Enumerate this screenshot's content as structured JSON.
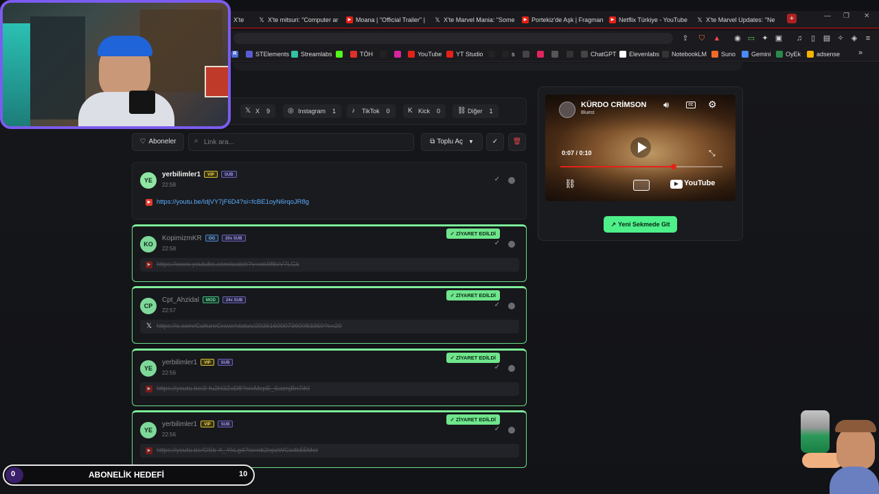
{
  "browser": {
    "tabs": [
      {
        "label": "X'te mitsuri: \"Computer ar",
        "icon": "x-icon"
      },
      {
        "label": "Moana | \"Official Trailer\" |",
        "icon": "youtube-icon"
      },
      {
        "label": "X'te Marvel Mania: \"Some",
        "icon": "x-icon"
      },
      {
        "label": "Portekiz'de Aşk | Fragman",
        "icon": "youtube-icon"
      },
      {
        "label": "Netflix Türkiye - YouTube",
        "icon": "youtube-icon"
      },
      {
        "label": "X'te Marvel Updates: \"Ne",
        "icon": "x-icon"
      }
    ],
    "first_tab_fragment": "X'te ",
    "bookmarks": [
      {
        "label": "STElements",
        "color": "#5b5bd6"
      },
      {
        "label": "Streamlabs",
        "color": "#31c3a2"
      },
      {
        "label": "",
        "color": "#53fc18"
      },
      {
        "label": "TÖH",
        "color": "#e0302a"
      },
      {
        "label": "",
        "color": "#222222"
      },
      {
        "label": "",
        "color": "#d6249f"
      },
      {
        "label": "YouTube",
        "color": "#e62117"
      },
      {
        "label": "YT Studio",
        "color": "#e62117"
      },
      {
        "label": "",
        "color": "#222222"
      },
      {
        "label": "s",
        "color": "#222222"
      },
      {
        "label": "",
        "color": "#444444"
      },
      {
        "label": "",
        "color": "#e0245e"
      },
      {
        "label": "",
        "color": "#555555"
      },
      {
        "label": "",
        "color": "#333333"
      },
      {
        "label": "ChatGPT",
        "color": "#444444"
      },
      {
        "label": "Elevenlabs",
        "color": "#ffffff"
      },
      {
        "label": "NotebookLM",
        "color": "#333333"
      },
      {
        "label": "Suno",
        "color": "#f06a2a"
      },
      {
        "label": "Gemini",
        "color": "#4a8af4"
      },
      {
        "label": "OyEk",
        "color": "#2a8a4a"
      },
      {
        "label": "adsense",
        "color": "#f4b400"
      }
    ]
  },
  "platforms": [
    {
      "label": "X",
      "count": "9",
      "icon": "x-icon"
    },
    {
      "label": "Instagram",
      "count": "1",
      "icon": "instagram-icon"
    },
    {
      "label": "TikTok",
      "count": "0",
      "icon": "tiktok-icon"
    },
    {
      "label": "Kick",
      "count": "0",
      "icon": "kick-icon"
    },
    {
      "label": "Diğer",
      "count": "1",
      "icon": "link-icon"
    }
  ],
  "filters": {
    "subscribers_label": "Aboneler",
    "search_placeholder": "Link ara...",
    "bulk_open_label": "Toplu Aç"
  },
  "links": [
    {
      "avatar": "YE",
      "user": "yerbilimler1",
      "badges": [
        [
          "VIP",
          "vip"
        ],
        [
          "SUB",
          "sub"
        ]
      ],
      "time": "22:58",
      "url": "https://youtu.be/IdjVY7jF6D4?si=fcBE1oyN6rqoJR8g",
      "platform": "yt",
      "visited": false
    },
    {
      "avatar": "KO",
      "user": "KopimizmKR",
      "badges": [
        [
          "OG",
          "og"
        ],
        [
          "20x SUB",
          "sub"
        ]
      ],
      "time": "22:58",
      "url": "https://www.youtube.com/watch?v=wk9f8uV7LGk",
      "platform": "yt",
      "visited": true
    },
    {
      "avatar": "CP",
      "user": "Cpt_Ahzidal",
      "badges": [
        [
          "MOD",
          "mod"
        ],
        [
          "24x SUB",
          "sub"
        ]
      ],
      "time": "22:57",
      "url": "https://x.com/CultureCrave/status/2036160007360083360?s=20",
      "platform": "x",
      "visited": true
    },
    {
      "avatar": "YE",
      "user": "yerbilimler1",
      "badges": [
        [
          "VIP",
          "vip"
        ],
        [
          "SUB",
          "sub"
        ]
      ],
      "time": "22:56",
      "url": "https://youtu.be/2-fu2H3ZvD8?si=McpE_SaznjBn7iKI",
      "platform": "yt",
      "visited": true
    },
    {
      "avatar": "YE",
      "user": "yerbilimler1",
      "badges": [
        [
          "VIP",
          "vip"
        ],
        [
          "SUB",
          "sub"
        ]
      ],
      "time": "22:56",
      "url": "https://youtu.be/OSb-X_YkLg4?si=nb2npzWCo4k55Mer",
      "platform": "yt",
      "visited": true
    }
  ],
  "visited_label": "✓ ZİYARET EDİLDİ",
  "player": {
    "title": "KÜRDO CRİMSON",
    "channel": "Bluest",
    "time": "0:07 / 0:10",
    "progress": 0.7,
    "brand": "YouTube",
    "cc_label": "CC",
    "open_new_tab": "Yeni Sekmede Git"
  },
  "overlay": {
    "goal_label": "ABONELİK HEDEFİ",
    "goal_current": "0",
    "goal_target": "10"
  },
  "colors": {
    "accent": "#4ef08a",
    "visited": "#6fe58c",
    "link": "#5aaefc",
    "webcam_border": "#7b5cf0"
  }
}
